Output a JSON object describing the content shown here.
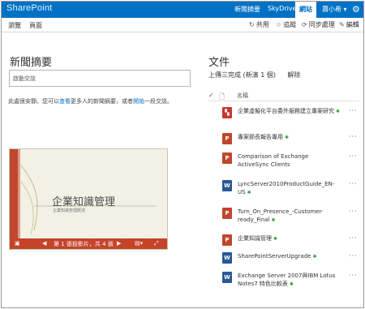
{
  "suite": {
    "brand": "SharePoint",
    "links": [
      {
        "label": "新聞摘要",
        "active": false
      },
      {
        "label": "SkyDrive",
        "active": false
      },
      {
        "label": "網站",
        "active": true
      }
    ],
    "user": "蕭小希 ▾",
    "gear_icon": "gear-icon"
  },
  "ribbon": {
    "tabs": [
      "瀏覽",
      "頁面"
    ],
    "actions": [
      {
        "icon": "share-icon",
        "label": "共用"
      },
      {
        "icon": "star-icon",
        "label": "追蹤"
      },
      {
        "icon": "sync-icon",
        "label": "同步處理"
      },
      {
        "icon": "edit-icon",
        "label": "編輯"
      }
    ]
  },
  "news": {
    "heading": "新聞摘要",
    "placeholder": "啟動交談",
    "tip_prefix": "此處很安靜。您可以",
    "tip_link1": "查看",
    "tip_middle": "更多人的新聞摘要，或者",
    "tip_link2": "開始",
    "tip_suffix": "一段交談。"
  },
  "viewer": {
    "slide_title": "企業知識管理",
    "slide_subtitle": "企業知識管理概述",
    "page_info": "第 1 張投影片，共 4 張"
  },
  "documents": {
    "heading": "文件",
    "upload_status": "上傳三完成 (新演 1 個)",
    "sync_label": "解除",
    "column_name": "名稱",
    "files": [
      {
        "name": "企業虛擬化平台委外服務建立專案研究",
        "type": "pdf",
        "color": "#c8372d",
        "glyph": "A",
        "new": "✱"
      },
      {
        "name": "專案節長報告專用",
        "type": "excel",
        "color": "#c0462d",
        "glyph": "P",
        "new": "✱"
      },
      {
        "name": "Comparison of Exchange ActiveSync Clients",
        "type": "word",
        "color": "#c0462d",
        "glyph": "P",
        "new": ""
      },
      {
        "name": "LyncServer2010ProductGuide_EN-US",
        "type": "word",
        "color": "#2b5797",
        "glyph": "W",
        "new": "✱"
      },
      {
        "name": "Turn_On_Presence_-Customer-ready_Final",
        "type": "ppt",
        "color": "#c0462d",
        "glyph": "P",
        "new": "✱"
      },
      {
        "name": "企業知識管理",
        "type": "ppt",
        "color": "#c0462d",
        "glyph": "P",
        "new": "✱"
      },
      {
        "name": "SharePointServerUpgrade",
        "type": "word",
        "color": "#2b5797",
        "glyph": "W",
        "new": "✱"
      },
      {
        "name": "Exchange Server 2007與IBM Lotus Notes7 特色比較表",
        "type": "word",
        "color": "#2b5797",
        "glyph": "W",
        "new": "✱"
      }
    ]
  }
}
